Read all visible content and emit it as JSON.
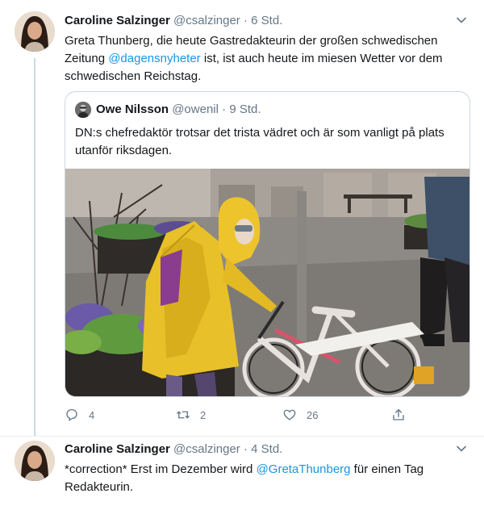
{
  "tweets": [
    {
      "author_name": "Caroline Salzinger",
      "handle": "@csalzinger",
      "separator": "·",
      "time": "6 Std.",
      "text_before": "Greta Thunberg, die heute Gastredakteurin der großen schwedischen Zeitung ",
      "mention": "@dagensnyheter",
      "text_after": " ist, ist auch heute im miesen Wetter vor dem schwedischen Reichstag.",
      "quoted": {
        "author_name": "Owe Nilsson",
        "handle": "@owenil",
        "separator": "·",
        "time": "9 Std.",
        "text": "DN:s chefredaktör trotsar det trista vädret och är som vanligt på plats utanför riksdagen."
      },
      "actions": {
        "reply_count": "4",
        "retweet_count": "2",
        "like_count": "26"
      }
    },
    {
      "author_name": "Caroline Salzinger",
      "handle": "@csalzinger",
      "separator": "·",
      "time": "4 Std.",
      "text_before": "*correction* Erst im Dezember wird ",
      "mention": "@GretaThunberg",
      "text_after": " für einen Tag Redakteurin."
    }
  ],
  "colors": {
    "link": "#1b95e0",
    "muted": "#657786",
    "border": "#ccd6dd",
    "raincoat": "#e8c02a"
  },
  "icons": [
    "reply-icon",
    "retweet-icon",
    "like-icon",
    "share-icon",
    "chevron-down-icon"
  ]
}
